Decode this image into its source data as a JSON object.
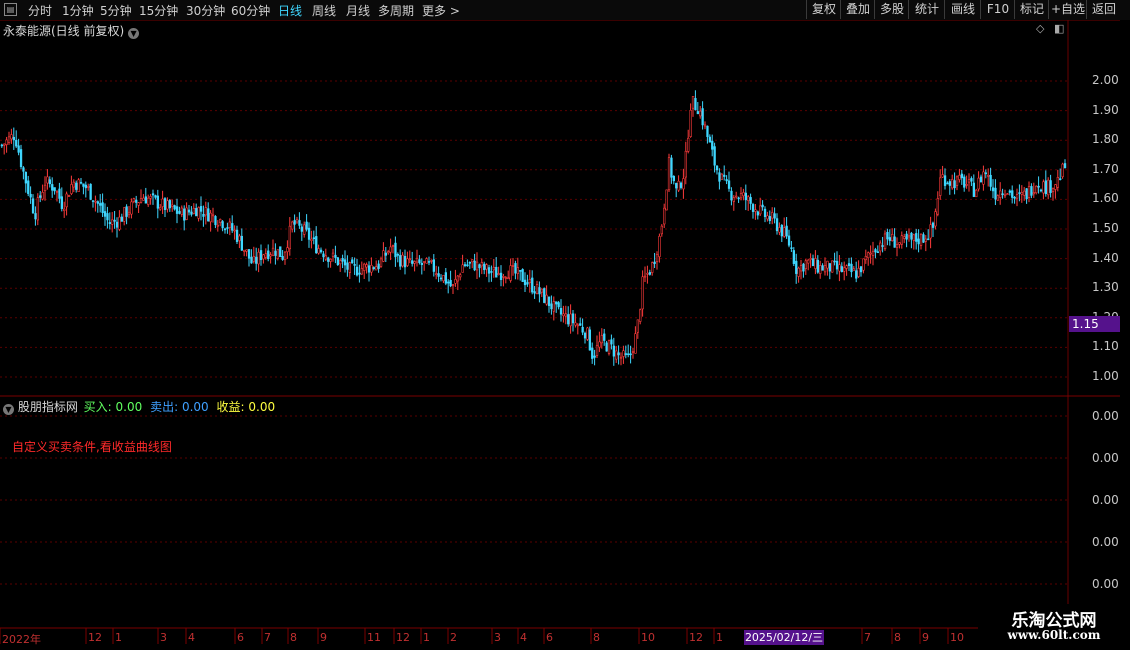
{
  "toolbar": {
    "periods": [
      "分时",
      "1分钟",
      "5分钟",
      "15分钟",
      "30分钟",
      "60分钟",
      "日线",
      "周线",
      "月线",
      "多周期",
      "更多 >"
    ],
    "active_period": "日线",
    "right_buttons": [
      "复权",
      "叠加",
      "多股",
      "统计",
      "画线",
      "F10",
      "标记",
      "+自选",
      "返回"
    ]
  },
  "chart_header": {
    "title": "永泰能源(日线 前复权)"
  },
  "indicator": {
    "name": "股朋指标网",
    "buy_label": "买入:",
    "buy_value": "0.00",
    "sell_label": "卖出:",
    "sell_value": "0.00",
    "profit_label": "收益:",
    "profit_value": "0.00",
    "note": "自定义买卖条件,看收益曲线图",
    "axis_values": [
      "0.00",
      "0.00",
      "0.00",
      "0.00",
      "0.00"
    ]
  },
  "current_price": "1.15",
  "current_date": "2025/02/12/三",
  "watermark": {
    "line1": "乐淘公式网",
    "line2": "www.60lt.com"
  },
  "colors": {
    "up": "#ff3b3b",
    "down": "#3fd7ff",
    "grid": "#5a0000",
    "accent": "#55128c"
  },
  "chart_data": {
    "type": "candlestick",
    "y_ticks": [
      2.0,
      1.9,
      1.8,
      1.7,
      1.6,
      1.5,
      1.4,
      1.3,
      1.2,
      1.1,
      1.0
    ],
    "ylim": [
      0.95,
      2.1
    ],
    "x_tick_labels": [
      "2022年",
      "12",
      "1",
      "3",
      "4",
      "6",
      "7",
      "8",
      "9",
      "11",
      "12",
      "1",
      "2",
      "3",
      "4",
      "6",
      "8",
      "10",
      "12",
      "1",
      "7",
      "8",
      "9",
      "10"
    ],
    "close_path": [
      [
        0,
        1.78
      ],
      [
        14,
        1.82
      ],
      [
        22,
        1.7
      ],
      [
        34,
        1.55
      ],
      [
        44,
        1.66
      ],
      [
        54,
        1.64
      ],
      [
        62,
        1.58
      ],
      [
        72,
        1.66
      ],
      [
        86,
        1.64
      ],
      [
        98,
        1.58
      ],
      [
        108,
        1.52
      ],
      [
        118,
        1.53
      ],
      [
        132,
        1.58
      ],
      [
        142,
        1.61
      ],
      [
        156,
        1.59
      ],
      [
        168,
        1.57
      ],
      [
        182,
        1.55
      ],
      [
        196,
        1.57
      ],
      [
        208,
        1.55
      ],
      [
        220,
        1.53
      ],
      [
        234,
        1.49
      ],
      [
        244,
        1.43
      ],
      [
        252,
        1.38
      ],
      [
        262,
        1.42
      ],
      [
        274,
        1.43
      ],
      [
        282,
        1.41
      ],
      [
        292,
        1.52
      ],
      [
        304,
        1.49
      ],
      [
        316,
        1.44
      ],
      [
        328,
        1.41
      ],
      [
        338,
        1.39
      ],
      [
        350,
        1.36
      ],
      [
        364,
        1.37
      ],
      [
        378,
        1.38
      ],
      [
        390,
        1.44
      ],
      [
        398,
        1.4
      ],
      [
        410,
        1.38
      ],
      [
        422,
        1.38
      ],
      [
        432,
        1.37
      ],
      [
        442,
        1.34
      ],
      [
        452,
        1.3
      ],
      [
        462,
        1.38
      ],
      [
        474,
        1.38
      ],
      [
        486,
        1.36
      ],
      [
        496,
        1.35
      ],
      [
        508,
        1.36
      ],
      [
        520,
        1.34
      ],
      [
        534,
        1.3
      ],
      [
        546,
        1.26
      ],
      [
        556,
        1.22
      ],
      [
        566,
        1.2
      ],
      [
        576,
        1.18
      ],
      [
        586,
        1.15
      ],
      [
        592,
        1.07
      ],
      [
        600,
        1.12
      ],
      [
        610,
        1.1
      ],
      [
        618,
        1.07
      ],
      [
        628,
        1.06
      ],
      [
        636,
        1.15
      ],
      [
        642,
        1.32
      ],
      [
        652,
        1.38
      ],
      [
        660,
        1.49
      ],
      [
        668,
        1.72
      ],
      [
        676,
        1.62
      ],
      [
        684,
        1.7
      ],
      [
        690,
        1.93
      ],
      [
        698,
        1.91
      ],
      [
        706,
        1.82
      ],
      [
        714,
        1.72
      ],
      [
        722,
        1.66
      ],
      [
        730,
        1.62
      ],
      [
        742,
        1.61
      ],
      [
        752,
        1.58
      ],
      [
        762,
        1.55
      ],
      [
        772,
        1.53
      ],
      [
        782,
        1.49
      ],
      [
        790,
        1.44
      ],
      [
        796,
        1.36
      ],
      [
        806,
        1.39
      ],
      [
        818,
        1.37
      ],
      [
        830,
        1.37
      ],
      [
        842,
        1.36
      ],
      [
        856,
        1.35
      ],
      [
        866,
        1.4
      ],
      [
        878,
        1.45
      ],
      [
        888,
        1.47
      ],
      [
        898,
        1.45
      ],
      [
        910,
        1.46
      ],
      [
        922,
        1.47
      ],
      [
        932,
        1.5
      ],
      [
        940,
        1.68
      ],
      [
        950,
        1.66
      ],
      [
        962,
        1.66
      ],
      [
        974,
        1.63
      ],
      [
        984,
        1.7
      ],
      [
        994,
        1.62
      ],
      [
        1004,
        1.64
      ],
      [
        1016,
        1.6
      ],
      [
        1026,
        1.62
      ],
      [
        1036,
        1.66
      ],
      [
        1046,
        1.64
      ],
      [
        1056,
        1.66
      ],
      [
        1064,
        1.71
      ],
      [
        1068,
        1.74
      ]
    ]
  }
}
